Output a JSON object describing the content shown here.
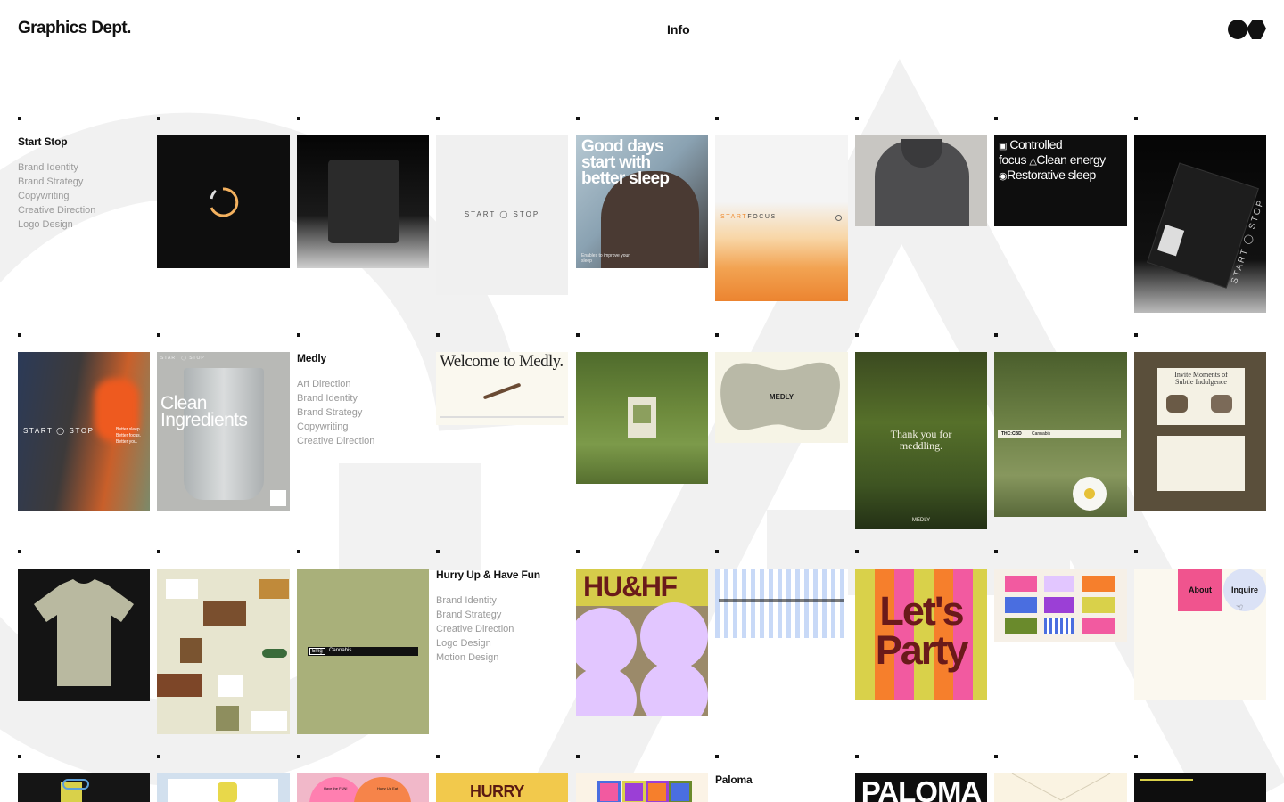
{
  "header": {
    "logo": "Graphics Dept.",
    "nav_info": "Info"
  },
  "projects": [
    {
      "title": "Start Stop",
      "services": [
        "Brand Identity",
        "Brand Strategy",
        "Copywriting",
        "Creative Direction",
        "Logo Design"
      ]
    },
    {
      "title": "Medly",
      "services": [
        "Art Direction",
        "Brand Identity",
        "Brand Strategy",
        "Copywriting",
        "Creative Direction"
      ]
    },
    {
      "title": "Hurry Up & Have Fun",
      "services": [
        "Brand Identity",
        "Brand Strategy",
        "Creative Direction",
        "Logo Design",
        "Motion Design"
      ]
    },
    {
      "title": "Paloma",
      "services": []
    }
  ],
  "tiles": {
    "startstop_logo": "START ◯ STOP",
    "goodday": [
      "Good days",
      "start with",
      "better sleep"
    ],
    "goodday_small": "Enables to improve your sleep",
    "startfocus_accent": "START",
    "startfocus_rest": "FOCUS",
    "controlled": [
      "Controlled",
      "focus",
      "Clean energy",
      "Restorative sleep"
    ],
    "pkg_text": "START ◯ STOP",
    "runners_text": "START ◯ STOP",
    "runners_side": [
      "Better sleep.",
      "Better focus.",
      "Better you."
    ],
    "clean": [
      "Clean",
      "Ingredients"
    ],
    "clean_top": "START ◯ STOP",
    "welcome": "Welcome to Medly.",
    "blob": "MEDLY",
    "thankyou": [
      "Thank you for",
      "meddling."
    ],
    "thankyou_small": "MEDLY",
    "thc_tags": [
      "THC:CBD",
      "Cannabis"
    ],
    "invite": [
      "Invite Moments of",
      "Subtle Indulgence"
    ],
    "green_tags": [
      "5mg",
      "Cannabis"
    ],
    "huhf": "HU&HF",
    "party": [
      "Let's",
      "Party"
    ],
    "about": "About",
    "inquire": "Inquire",
    "hurry_yellow": "HURRY",
    "paloma": "PALOMA",
    "pink_texts": [
      "Have the FUN!",
      "Hurry Up Eat"
    ]
  },
  "colors": {
    "black": "#0e0e0e",
    "grey_light": "#f0f0f0",
    "orange": "#ef8a2f",
    "sage": "#a9b07a",
    "party_yellow": "#d9d14a",
    "pink": "#f25aa0",
    "lilac": "#e2c6ff",
    "brown": "#5a4f3b"
  }
}
